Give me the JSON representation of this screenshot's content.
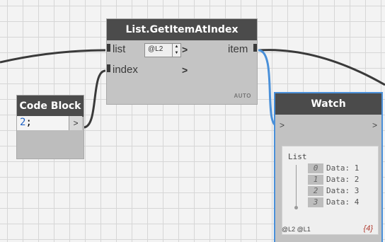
{
  "colors": {
    "wire": "#3a3a3a",
    "wire_selected": "#4a90d9",
    "node_header": "#4b4b4b",
    "selected_border": "#4a90d9"
  },
  "get_item_node": {
    "title": "List.GetItemAtIndex",
    "inputs": [
      {
        "label": "list",
        "lacing": "@L2",
        "arrow": ">"
      },
      {
        "label": "index",
        "arrow": ">"
      }
    ],
    "output": {
      "label": "item"
    },
    "run_mode": "AUTO"
  },
  "code_block_node": {
    "title": "Code Block",
    "code_value": "2",
    "code_suffix": ";",
    "output_arrow": ">"
  },
  "watch_node": {
    "title": "Watch",
    "input_arrow": ">",
    "output_arrow": ">",
    "list_label": "List",
    "items": [
      {
        "index": "0",
        "text": "Data: 1"
      },
      {
        "index": "1",
        "text": "Data: 2"
      },
      {
        "index": "2",
        "text": "Data: 3"
      },
      {
        "index": "3",
        "text": "Data: 4"
      }
    ],
    "levels": "@L2 @L1",
    "count": "{4}"
  }
}
